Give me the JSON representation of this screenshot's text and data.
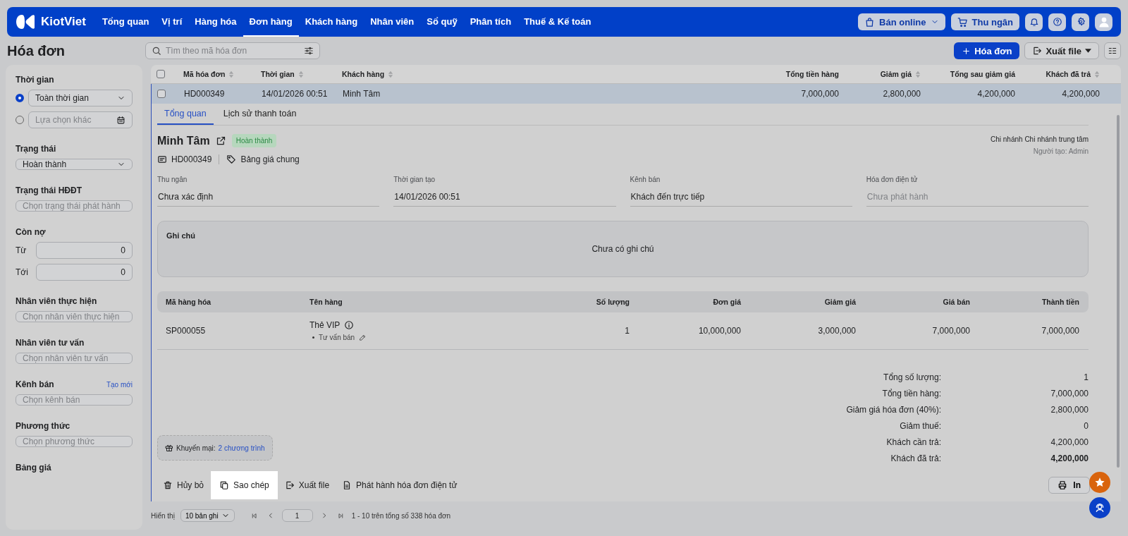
{
  "brand": "KiotViet",
  "nav": [
    {
      "label": "Tổng quan",
      "selected": false
    },
    {
      "label": "Vị trí",
      "selected": false
    },
    {
      "label": "Hàng hóa",
      "selected": false
    },
    {
      "label": "Đơn hàng",
      "selected": true
    },
    {
      "label": "Khách hàng",
      "selected": false
    },
    {
      "label": "Nhân viên",
      "selected": false
    },
    {
      "label": "Sổ quỹ",
      "selected": false
    },
    {
      "label": "Phân tích",
      "selected": false
    },
    {
      "label": "Thuế & Kế toán",
      "selected": false
    }
  ],
  "top_actions": {
    "online": "Bán online",
    "cashier": "Thu ngân"
  },
  "page_title": "Hóa đơn",
  "search": {
    "placeholder": "Tìm theo mã hóa đơn"
  },
  "toolbar": {
    "new": "Hóa đơn",
    "export": "Xuất file"
  },
  "sidebar": {
    "sections": [
      {
        "kind": "radios",
        "label": "Thời gian",
        "options": [
          {
            "kind": "select",
            "value": "Toàn thời gian",
            "selected": true
          },
          {
            "kind": "date",
            "placeholder": "Lựa chọn khác",
            "selected": false
          }
        ]
      },
      {
        "kind": "select",
        "label": "Trạng thái",
        "value": "Hoàn thành"
      },
      {
        "kind": "input",
        "label": "Trạng thái HĐĐT",
        "placeholder": "Chọn trạng thái phát hành"
      },
      {
        "kind": "range",
        "label": "Còn nợ",
        "rows": [
          {
            "label": "Từ",
            "value": "0"
          },
          {
            "label": "Tới",
            "value": "0"
          }
        ]
      },
      {
        "kind": "input",
        "label": "Nhân viên thực hiện",
        "placeholder": "Chọn nhân viên thực hiện"
      },
      {
        "kind": "input",
        "label": "Nhân viên tư vấn",
        "placeholder": "Chọn nhân viên tư vấn"
      },
      {
        "kind": "input",
        "label": "Kênh bán",
        "link": "Tạo mới",
        "placeholder": "Chọn kênh bán"
      },
      {
        "kind": "input",
        "label": "Phương thức",
        "placeholder": "Chọn phương thức"
      },
      {
        "kind": "heading",
        "label": "Bảng giá"
      }
    ]
  },
  "table": {
    "select_all_checked": false,
    "columns": [
      {
        "label": "Mã hóa đơn",
        "sortable": true
      },
      {
        "label": "Thời gian",
        "sortable": true
      },
      {
        "label": "Khách hàng",
        "sortable": true
      },
      {
        "label": "Tổng tiền hàng",
        "sortable": false
      },
      {
        "label": "Giảm giá",
        "sortable": true
      },
      {
        "label": "Tổng sau giảm giá",
        "sortable": false
      },
      {
        "label": "Khách đã trả",
        "sortable": true
      }
    ],
    "rows": [
      {
        "selected": true,
        "checked": false,
        "cells": [
          "HD000349",
          "14/01/2026 00:51",
          "Minh Tâm",
          "7,000,000",
          "2,800,000",
          "4,200,000",
          "4,200,000"
        ]
      }
    ]
  },
  "detail": {
    "tabs": [
      {
        "label": "Tổng quan",
        "selected": true
      },
      {
        "label": "Lịch sử thanh toán",
        "selected": false
      }
    ],
    "customer": "Minh Tâm",
    "status": "Hoàn thành",
    "code": "HD000349",
    "price_list": "Bảng giá chung",
    "branch": "Chi nhánh Chi nhánh trung tâm",
    "creator": "Người tạo: Admin",
    "fields": [
      {
        "label": "Thu ngân",
        "value": "Chưa xác định"
      },
      {
        "label": "Thời gian tạo",
        "value": "14/01/2026 00:51"
      },
      {
        "label": "Kênh bán",
        "value": "Khách đến trực tiếp"
      },
      {
        "label": "Hóa đơn điện tử",
        "placeholder": "Chưa phát hành"
      }
    ],
    "note": {
      "label": "Ghi chú",
      "text": "Chưa có ghi chú"
    },
    "items": {
      "columns": [
        "Mã hàng hóa",
        "Tên hàng",
        "Số lượng",
        "Đơn giá",
        "Giảm giá",
        "Giá bán",
        "Thành tiền"
      ],
      "rows": [
        {
          "code": "SP000055",
          "name": "Thẻ VIP",
          "sub": "Tư vấn bán",
          "quantity": "1",
          "unit_price": "10,000,000",
          "discount": "3,000,000",
          "sale_price": "7,000,000",
          "total": "7,000,000"
        }
      ]
    },
    "promo": {
      "label": "Khuyến mại:",
      "link": "2 chương trình"
    },
    "summary": [
      {
        "label": "Tổng số lượng:",
        "value": "1",
        "bold": false
      },
      {
        "label": "Tổng tiền hàng:",
        "value": "7,000,000",
        "bold": false
      },
      {
        "label": "Giảm giá hóa đơn (40%):",
        "value": "2,800,000",
        "bold": false
      },
      {
        "label": "Giảm thuế:",
        "value": "0",
        "bold": false
      },
      {
        "label": "Khách cần trả:",
        "value": "4,200,000",
        "bold": false
      },
      {
        "label": "Khách đã trả:",
        "value": "4,200,000",
        "bold": true
      }
    ],
    "actions": [
      {
        "kind": "delete",
        "label": "Hủy bỏ",
        "highlighted": false
      },
      {
        "kind": "copy",
        "label": "Sao chép",
        "highlighted": true
      },
      {
        "kind": "export",
        "label": "Xuất file",
        "highlighted": false
      },
      {
        "kind": "einvoice",
        "label": "Phát hành hóa đơn điện tử",
        "highlighted": false
      }
    ],
    "print": "In"
  },
  "pagination": {
    "label": "Hiển thị",
    "page_size": "10 bản ghi",
    "page": "1",
    "summary": "1 - 10 trên tổng số 338 hóa đơn"
  }
}
